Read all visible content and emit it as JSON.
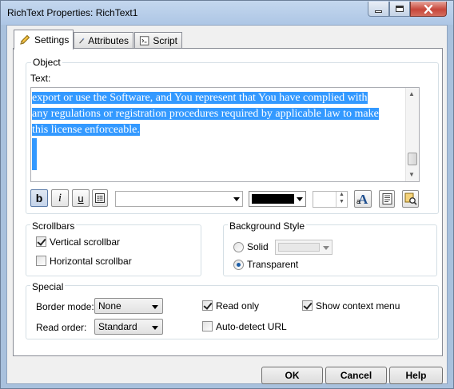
{
  "window": {
    "title": "RichText Properties: RichText1"
  },
  "tabs": [
    {
      "label": "Settings",
      "icon": "pencil-icon",
      "active": true
    },
    {
      "label": "Attributes",
      "icon": "wand-icon",
      "active": false
    },
    {
      "label": "Script",
      "icon": "script-icon",
      "active": false
    }
  ],
  "object_group": {
    "label": "Object",
    "text_label": "Text:",
    "text_lines": [
      "export or use the Software, and You represent that You have complied with",
      "any regulations or registration procedures required by applicable law to make",
      "this license enforceable."
    ]
  },
  "toolbar": {
    "bold": "b",
    "italic": "i",
    "underline": "u",
    "font_value": "",
    "color_value": "#000000",
    "size_value": ""
  },
  "scrollbars": {
    "label": "Scrollbars",
    "vertical": {
      "label": "Vertical scrollbar",
      "checked": true
    },
    "horizontal": {
      "label": "Horizontal scrollbar",
      "checked": false
    }
  },
  "background_style": {
    "label": "Background Style",
    "solid": {
      "label": "Solid",
      "checked": false
    },
    "transparent": {
      "label": "Transparent",
      "checked": true
    }
  },
  "special": {
    "label": "Special",
    "border_mode_label": "Border mode:",
    "border_mode_value": "None",
    "read_order_label": "Read order:",
    "read_order_value": "Standard",
    "read_only": {
      "label": "Read only",
      "checked": true
    },
    "auto_detect_url": {
      "label": "Auto-detect URL",
      "checked": false
    },
    "show_context_menu": {
      "label": "Show context menu",
      "checked": true
    }
  },
  "buttons": {
    "ok": "OK",
    "cancel": "Cancel",
    "help": "Help"
  }
}
